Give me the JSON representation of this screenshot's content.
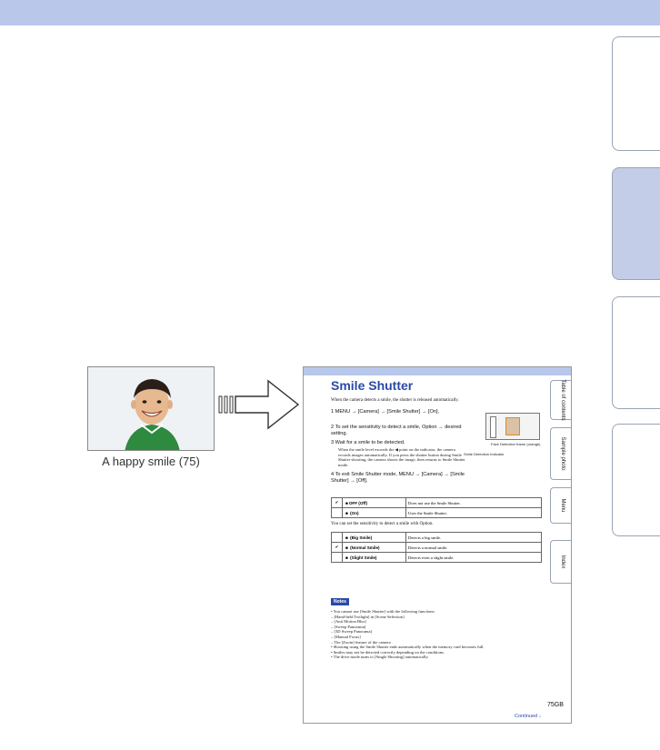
{
  "photo_caption": "A happy smile (75)",
  "preview": {
    "title": "Smile Shutter",
    "intro": "When the camera detects a smile, the shutter is released automatically.",
    "steps": [
      {
        "text": "1  MENU → [Camera] → [Smile Shutter] → [On]."
      },
      {
        "text": "2  To set the sensitivity to detect a smile, Option → desired setting."
      },
      {
        "text": "3  Wait for a smile to be detected."
      },
      {
        "text": "4  To exit Smile Shutter mode, MENU → [Camera] → [Smile Shutter] → [Off]."
      }
    ],
    "step3_detail": "When the smile level exceeds the ◀ point on the indicator, the camera records images automatically. If you press the shutter button during Smile Shutter shooting, the camera shoots the image, then returns to Smile Shutter mode.",
    "cam_labels": {
      "face_frame": "Face Detection frame (orange)",
      "indicator": "Smile Detection Indicator"
    },
    "table1": [
      {
        "check": "✔",
        "label": "☻OFF (Off)",
        "desc": "Does not use the Smile Shutter."
      },
      {
        "check": "",
        "label": "☻ (On)",
        "desc": "Uses the Smile Shutter."
      }
    ],
    "option_text": "You can set the sensitivity to detect a smile with Option.",
    "table2": [
      {
        "check": "",
        "label": "☻ (Big Smile)",
        "desc": "Detects a big smile."
      },
      {
        "check": "✔",
        "label": "☻ (Normal Smile)",
        "desc": "Detects a normal smile."
      },
      {
        "check": "",
        "label": "☻ (Slight Smile)",
        "desc": "Detects even a slight smile."
      }
    ],
    "notes_label": "Notes",
    "notes": [
      "• You cannot use [Smile Shutter] with the following functions:",
      "  – [Hand-held Twilight] in [Scene Selection]",
      "  – [Anti Motion Blur]",
      "  – [Sweep Panorama]",
      "  – [3D Sweep Panorama]",
      "  – [Manual Focus]",
      "  – The [Zoom] feature of the camera",
      "• Shooting using the Smile Shutter ends automatically when the memory card becomes full.",
      "• Smiles may not be detected correctly depending on the conditions.",
      "• The drive mode turns to [Single Shooting] automatically."
    ],
    "tabs": [
      "Table of contents",
      "Sample photo",
      "Menu",
      "Index"
    ],
    "page_number": "75GB",
    "continued": "Continued ↓"
  }
}
